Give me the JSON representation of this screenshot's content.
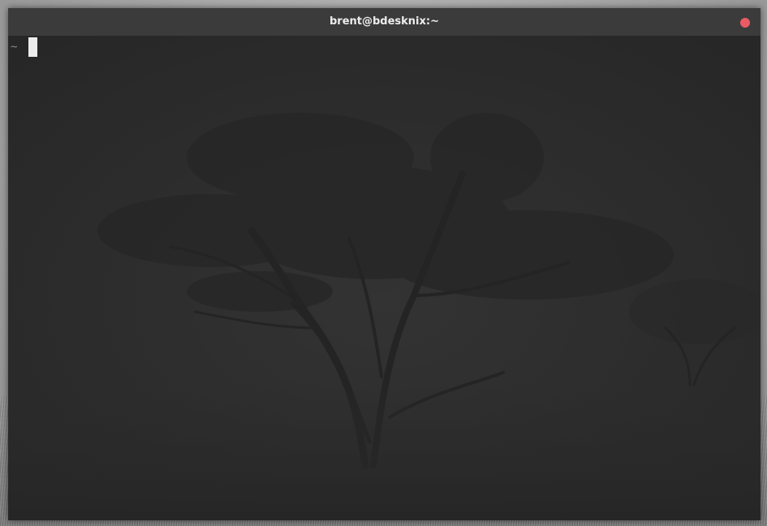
{
  "window": {
    "title": "brent@bdesknix:~",
    "close_color": "#e95b65",
    "close_icon": "close-dot-icon"
  },
  "terminal": {
    "prompt": "~",
    "input": "",
    "background_color": "#2d2d2d",
    "text_color": "#8a8a8a",
    "cursor_color": "#ececec"
  }
}
